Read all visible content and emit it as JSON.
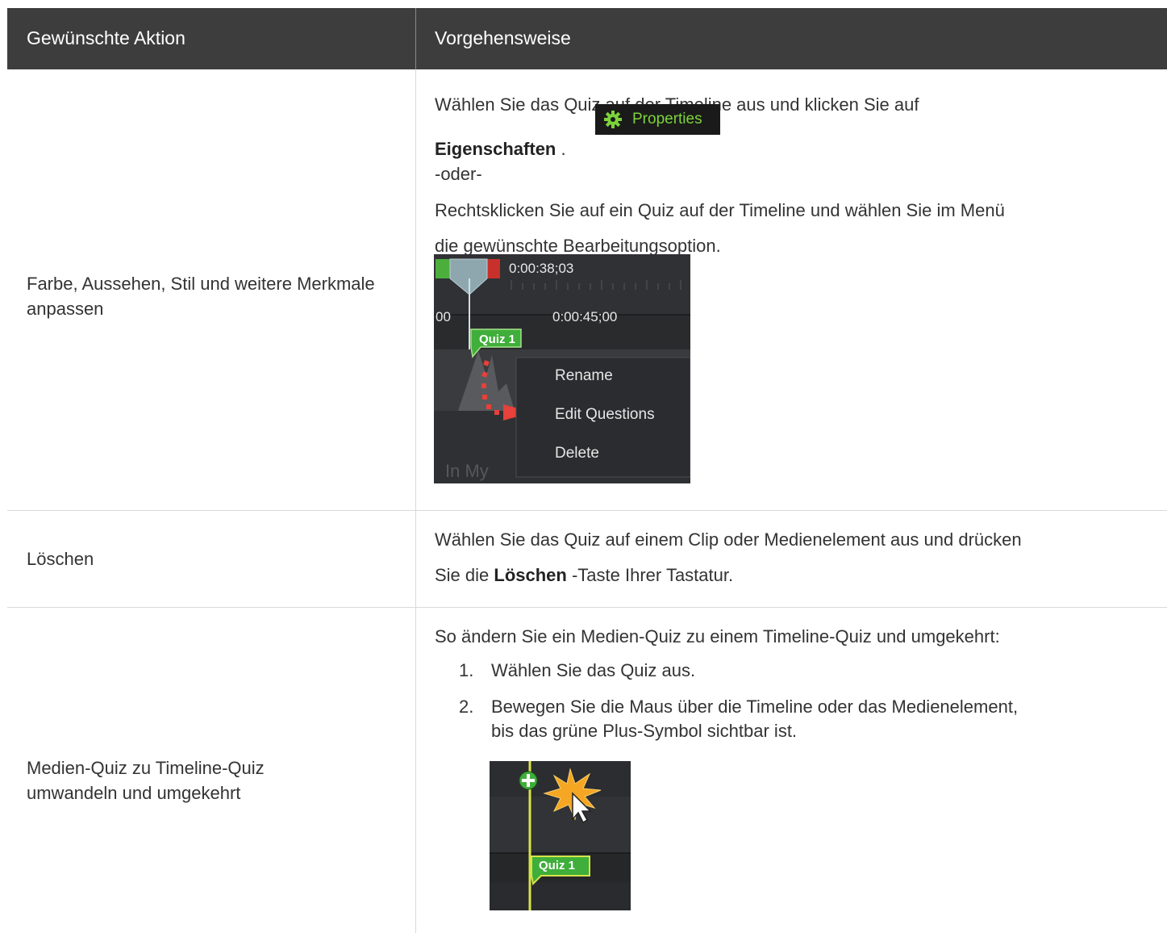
{
  "header": {
    "col1": "Gewünschte Aktion",
    "col2": "Vorgehensweise"
  },
  "rows": [
    {
      "action": "Farbe, Aussehen, Stil und weitere Merkmale anpassen",
      "line1": "Wählen Sie das Quiz auf der Timeline aus und klicken Sie auf",
      "bold1": "Eigenschaften",
      "after_bold1": " .",
      "properties_button": "Properties",
      "or": "-oder-",
      "line2": "Rechtsklicken Sie auf ein Quiz auf der Timeline und wählen Sie im Menü",
      "line3": "die gewünschte Bearbeitungsoption.",
      "screenshot": {
        "time_marker": "0:00:38;03",
        "ruler_left": "00",
        "ruler_time": "0:00:45;00",
        "quiz_label": "Quiz 1",
        "menu_items": [
          "Rename",
          "Edit Questions",
          "Delete"
        ],
        "bottom_text": "In My"
      }
    },
    {
      "action": "Löschen",
      "line1": "Wählen Sie das Quiz auf einem Clip oder Medienelement aus und drücken",
      "line2_pre": "Sie die ",
      "bold": "Löschen",
      "line2_post": " -Taste Ihrer Tastatur."
    },
    {
      "action_line1": "Medien-Quiz zu Timeline-Quiz",
      "action_line2": "umwandeln und umgekehrt",
      "intro": "So ändern Sie ein Medien-Quiz zu einem Timeline-Quiz und umgekehrt:",
      "steps": [
        {
          "num": "1.",
          "text": "Wählen Sie das Quiz aus."
        },
        {
          "num": "2.",
          "text_line1": "Bewegen Sie die Maus über die Timeline oder das Medienelement,",
          "text_line2": "bis das grüne Plus-Symbol sichtbar ist."
        }
      ],
      "screenshot": {
        "quiz_label": "Quiz 1"
      }
    }
  ],
  "colors": {
    "header_bg": "#3d3d3d",
    "border": "#d9d9d9",
    "accent_green": "#7cd33a",
    "arrow_red": "#e8403a"
  }
}
